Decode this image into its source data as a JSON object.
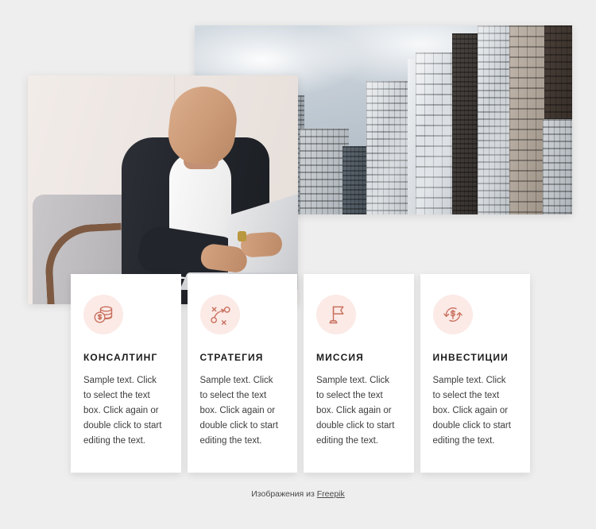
{
  "page": {
    "background_color": "#eeeeee",
    "accent_color": "#c9705e",
    "icon_bg_color": "#fbeae6"
  },
  "media": {
    "city_photo": {
      "alt": "Modern city skyscrapers under an overcast sky",
      "name": "city-skyline-photo"
    },
    "person_photo": {
      "alt": "Bearded businessman in dark blazer working on a laptop in an armchair",
      "name": "businessman-laptop-photo"
    }
  },
  "cards": [
    {
      "icon": "coins-stack-icon",
      "title": "КОНСАЛТИНГ",
      "text": "Sample text. Click to select the text box. Click again or double click to start editing the text."
    },
    {
      "icon": "strategy-tactics-icon",
      "title": "СТРАТЕГИЯ",
      "text": "Sample text. Click to select the text box. Click again or double click to start editing the text."
    },
    {
      "icon": "flag-icon",
      "title": "МИССИЯ",
      "text": "Sample text. Click to select the text box. Click again or double click to start editing the text."
    },
    {
      "icon": "money-recycle-icon",
      "title": "ИНВЕСТИЦИИ",
      "text": "Sample text. Click to select the text box. Click again or double click to start editing the text."
    }
  ],
  "footer": {
    "prefix": "Изображения из ",
    "link_label": "Freepik"
  }
}
